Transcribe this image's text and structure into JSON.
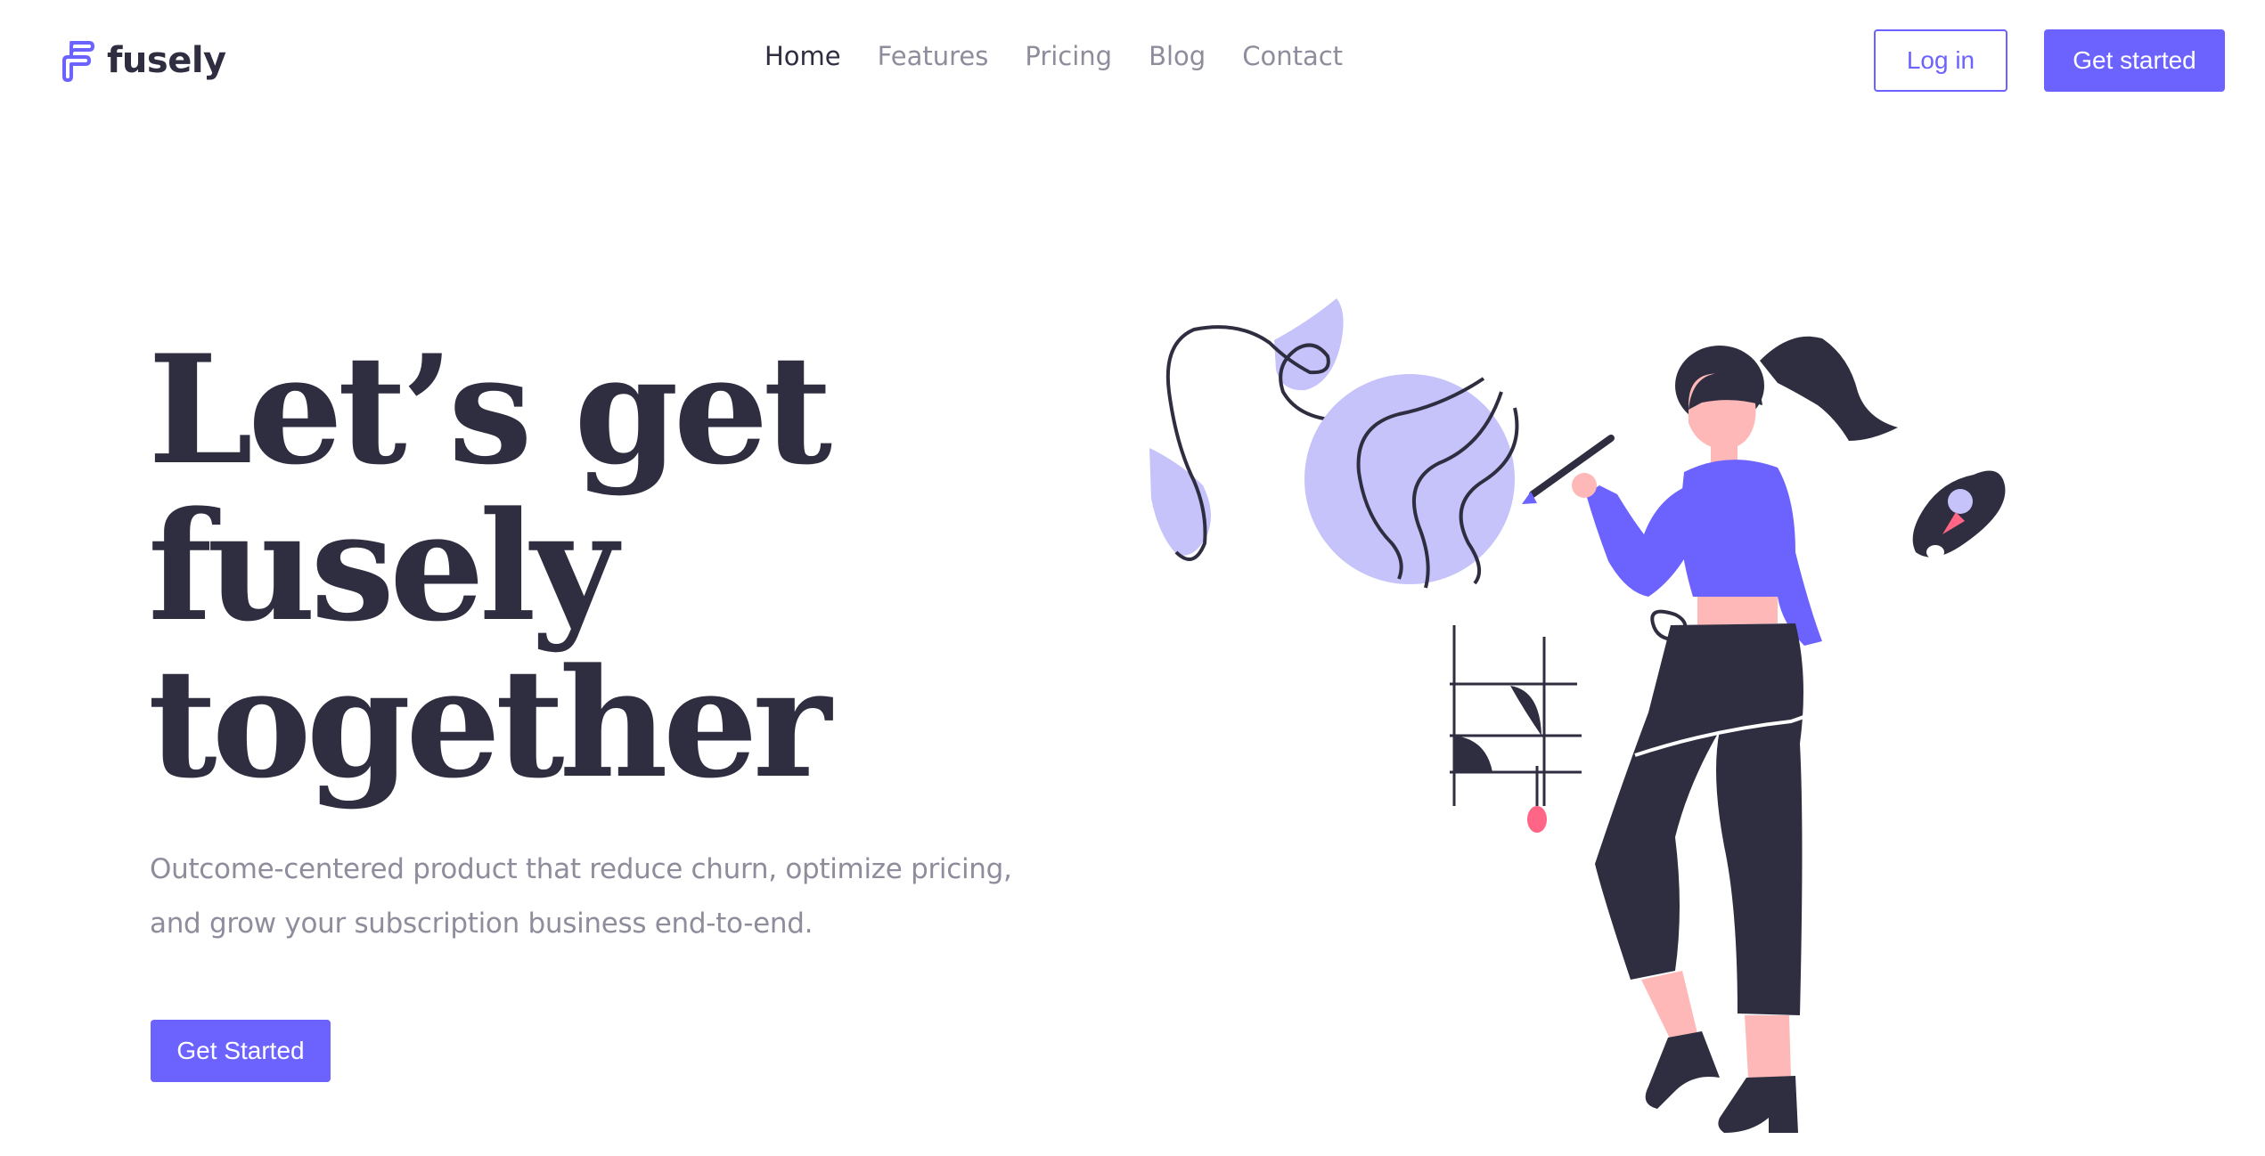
{
  "brand": {
    "name": "fusely",
    "logo_icon": "fusely-logo-icon",
    "accent_color": "#6c63ff",
    "dark_color": "#2f2e41",
    "muted_color": "#8f8c9c"
  },
  "nav": {
    "items": [
      {
        "label": "Home",
        "active": true
      },
      {
        "label": "Features",
        "active": false
      },
      {
        "label": "Pricing",
        "active": false
      },
      {
        "label": "Blog",
        "active": false
      },
      {
        "label": "Contact",
        "active": false
      }
    ]
  },
  "header_actions": {
    "login_label": "Log in",
    "get_started_label": "Get started"
  },
  "hero": {
    "title_lines": [
      "Let’s get",
      "fusely",
      "together"
    ],
    "subtitle_lines": [
      "Outcome-centered product that reduce churn, optimize pricing,",
      "and grow your subscription business end-to-end."
    ],
    "cta_label": "Get Started",
    "illustration_icon": "woman-painting-illustration",
    "illustration_colors": {
      "purple": "#6c63ff",
      "lavender": "#c6c3fb",
      "skin": "#ffb8b8",
      "dark": "#2f2e41",
      "pink": "#ff6584"
    }
  }
}
